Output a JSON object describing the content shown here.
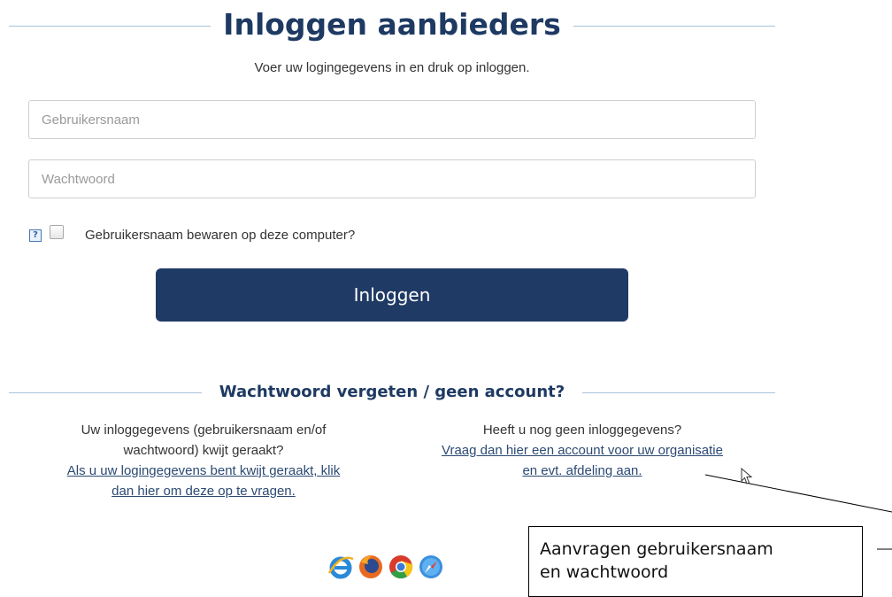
{
  "login": {
    "title": "Inloggen aanbieders",
    "subtitle": "Voer uw logingegevens in en druk op inloggen.",
    "username_placeholder": "Gebruikersnaam",
    "password_placeholder": "Wachtwoord",
    "help_icon": "?",
    "remember_label": "Gebruikersnaam bewaren op deze computer?",
    "login_button": "Inloggen"
  },
  "forgot": {
    "title": "Wachtwoord vergeten / geen account?",
    "left_text_1": "Uw inloggegevens (gebruikersnaam en/of",
    "left_text_2": "wachtwoord) kwijt geraakt?",
    "left_link_1": "Als u uw logingegevens bent kwijt geraakt, klik",
    "left_link_2": "dan hier om deze op te vragen.",
    "right_text_1": "Heeft u nog geen inloggegevens?",
    "right_link_1": "Vraag dan hier een account voor uw organisatie",
    "right_link_2": "en evt. afdeling aan."
  },
  "browsers": [
    "internet-explorer-icon",
    "firefox-icon",
    "chrome-icon",
    "safari-icon"
  ],
  "annotation": {
    "line_1": "Aanvragen gebruikersnaam",
    "line_2": "en wachtwoord"
  },
  "colors": {
    "brand_navy": "#1f3a64",
    "rule_blue": "#a9c4dc",
    "link": "#2c4a73"
  }
}
